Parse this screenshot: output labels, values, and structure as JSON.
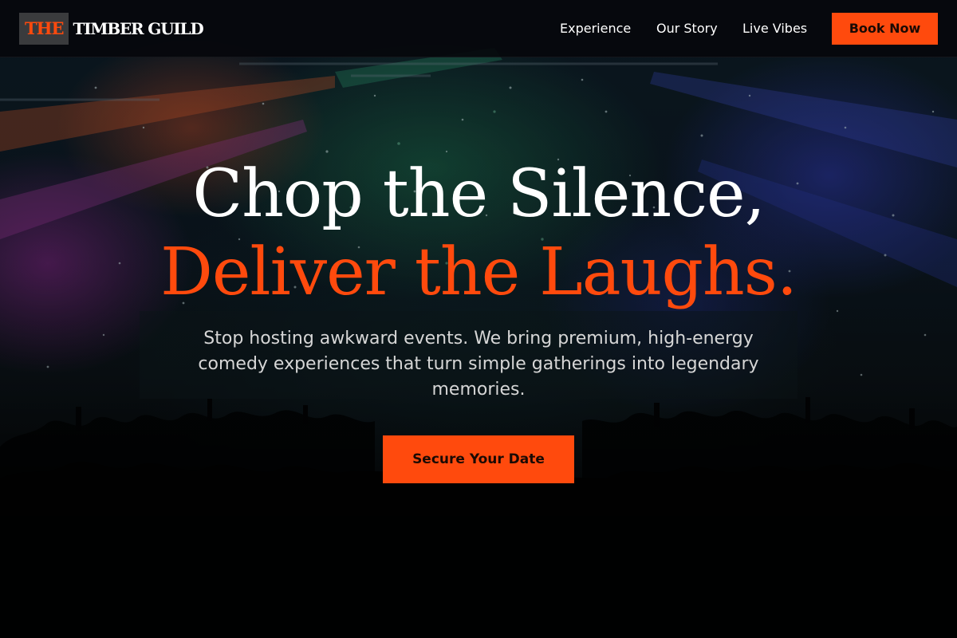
{
  "brand": {
    "logo_mark": "THE",
    "logo_text": "TIMBER GUILD"
  },
  "nav": {
    "links": [
      "Experience",
      "Our Story",
      "Live Vibes"
    ],
    "cta_label": "Book Now"
  },
  "hero": {
    "headline_line1": "Chop the Silence,",
    "headline_line2": "Deliver the Laughs.",
    "subtext": "Stop hosting awkward events. We bring premium, high-energy comedy experiences that turn simple gatherings into legendary memories.",
    "cta_label": "Secure Your Date"
  },
  "colors": {
    "accent": "#ff4a0d",
    "header_bg": "#06080c",
    "headline_primary": "#ffffff",
    "subtext": "#d6d6d6"
  }
}
